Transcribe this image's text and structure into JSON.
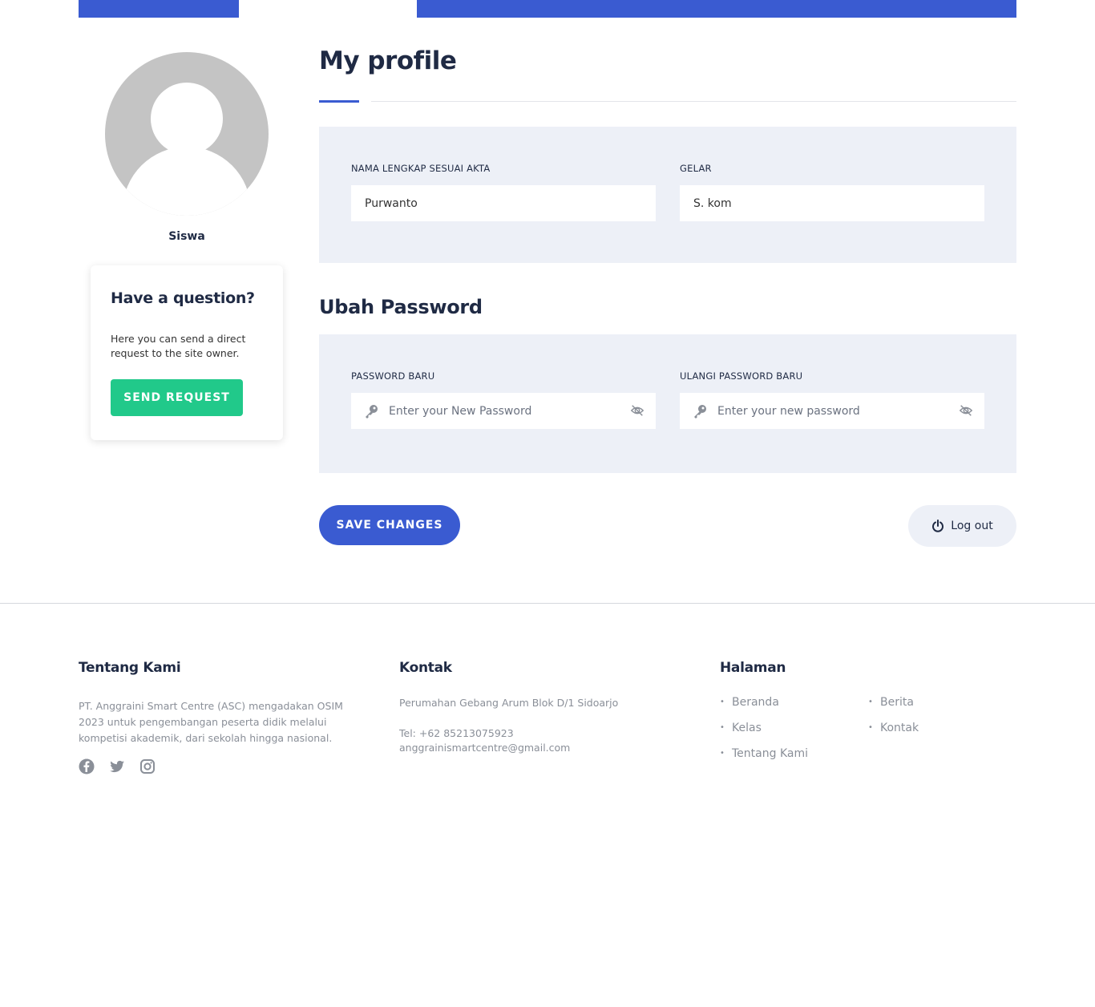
{
  "profile": {
    "role": "Siswa",
    "title": "My profile",
    "question_card": {
      "heading": "Have a question?",
      "text": "Here you can send a direct request to the site owner.",
      "button": "SEND REQUEST"
    },
    "fields": {
      "full_name_label": "NAMA LENGKAP SESUAI AKTA",
      "full_name_value": "Purwanto",
      "degree_label": "GELAR",
      "degree_value": "S. kom"
    }
  },
  "password": {
    "title": "Ubah Password",
    "new_label": "PASSWORD BARU",
    "new_placeholder": "Enter your New Password",
    "repeat_label": "ULANGI PASSWORD BARU",
    "repeat_placeholder": "Enter your new password"
  },
  "actions": {
    "save": "SAVE CHANGES",
    "logout": "Log out"
  },
  "footer": {
    "about": {
      "heading": "Tentang Kami",
      "text": "PT. Anggraini Smart Centre (ASC) mengadakan OSIM 2023 untuk pengembangan peserta didik melalui kompetisi akademik, dari sekolah hingga nasional."
    },
    "contact": {
      "heading": "Kontak",
      "address": "Perumahan Gebang Arum Blok D/1 Sidoarjo",
      "phone": "Tel: +62 85213075923",
      "email": "anggrainismartcentre@gmail.com"
    },
    "pages": {
      "heading": "Halaman",
      "col1": [
        "Beranda",
        "Kelas",
        "Tentang Kami"
      ],
      "col2": [
        "Berita",
        "Kontak"
      ]
    }
  },
  "icons": {
    "social": [
      "facebook-icon",
      "twitter-icon",
      "instagram-icon"
    ]
  },
  "colors": {
    "primary": "#3a5bd1",
    "accent_green": "#21c98a",
    "panel_bg": "#edf0f7"
  }
}
